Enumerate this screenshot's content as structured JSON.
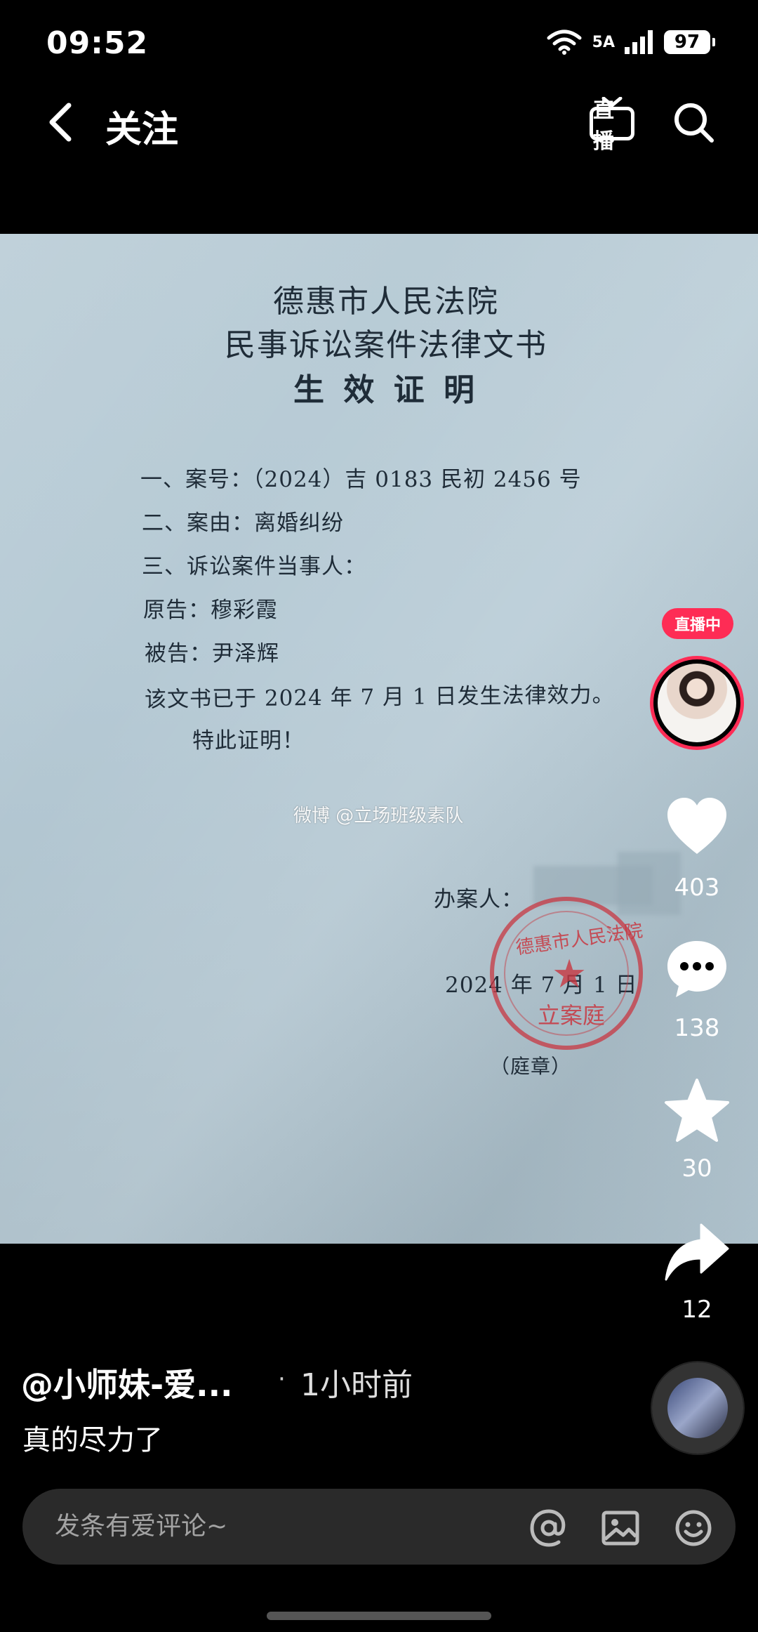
{
  "status_bar": {
    "time": "09:52",
    "wifi_label": "6",
    "signal_label": "5A",
    "battery": "97"
  },
  "nav": {
    "title": "关注",
    "live_label": "直播"
  },
  "document": {
    "court": "德惠市人民法院",
    "doc_type": "民事诉讼案件法律文书",
    "cert_title": "生 效 证 明",
    "lines": [
      "一、案号：（2024）吉 0183 民初 2456 号",
      "二、案由：离婚纠纷",
      "三、诉讼案件当事人：",
      "原告：穆彩霞",
      "被告：尹泽辉",
      "该文书已于 2024 年 7 月 1 日发生法律效力。",
      "特此证明！"
    ],
    "handler_label": "办案人：",
    "date": "2024 年  7 月 1 日",
    "seal_note": "（庭章）",
    "seal_text_top": "德惠市人民法院",
    "seal_text_bottom": "立案庭",
    "watermark": "微博 @立场班级素队"
  },
  "rail": {
    "live_badge": "直播中",
    "likes": "403",
    "comments": "138",
    "favorites": "30",
    "shares": "12"
  },
  "post": {
    "author": "@小师妹-爱...",
    "separator": "·",
    "time_ago": "1小时前",
    "caption": "真的尽力了"
  },
  "comment_bar": {
    "placeholder": "发条有爱评论~"
  },
  "colors": {
    "accent": "#fe2c55",
    "paper": "#b6cad5",
    "seal": "#c83741"
  }
}
